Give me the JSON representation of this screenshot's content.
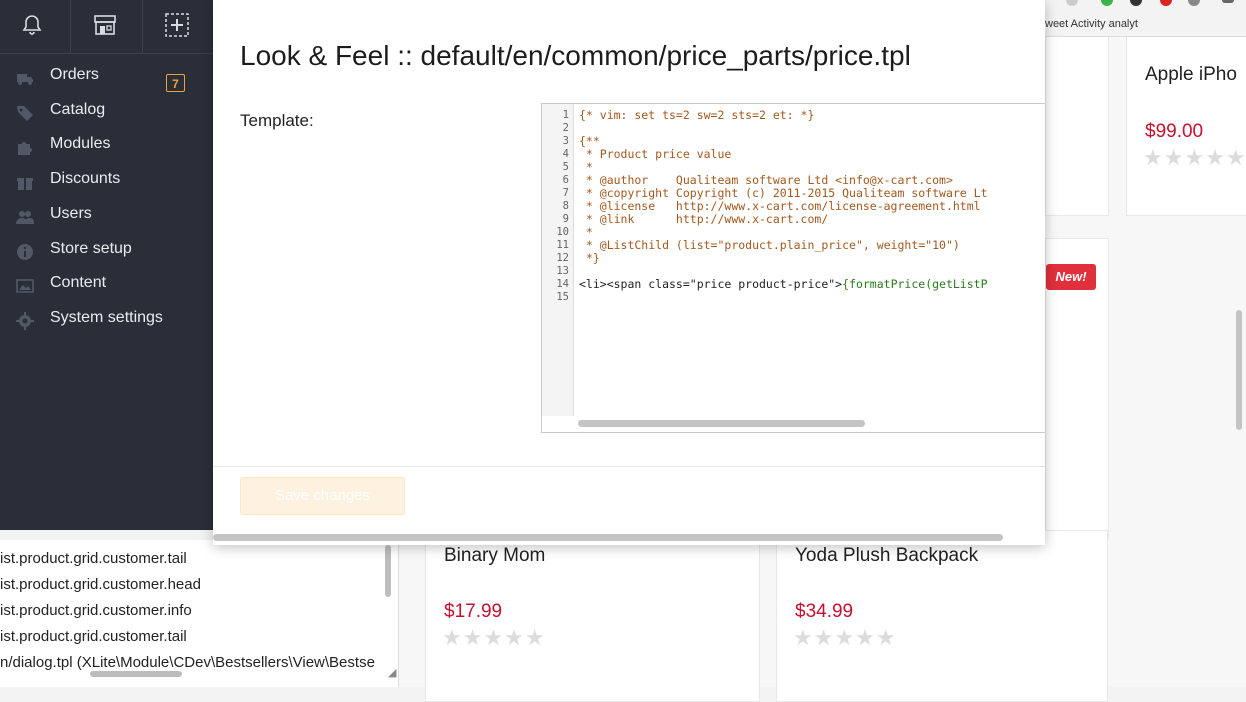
{
  "browser": {
    "tab_text": "weet Activity analyt"
  },
  "sidebar": {
    "toolbar": [
      {
        "icon": "bell-icon"
      },
      {
        "icon": "storefront-icon"
      },
      {
        "icon": "add-box-icon"
      }
    ],
    "items": [
      {
        "label": "Orders",
        "icon": "truck-icon",
        "badge": "7"
      },
      {
        "label": "Catalog",
        "icon": "tags-icon"
      },
      {
        "label": "Modules",
        "icon": "puzzle-icon"
      },
      {
        "label": "Discounts",
        "icon": "gift-icon"
      },
      {
        "label": "Users",
        "icon": "users-icon"
      },
      {
        "label": "Store setup",
        "icon": "info-icon"
      },
      {
        "label": "Content",
        "icon": "image-icon"
      },
      {
        "label": "System settings",
        "icon": "gear-icon"
      }
    ]
  },
  "modal": {
    "title": "Look & Feel :: default/en/common/price_parts/price.tpl",
    "template_label": "Template:",
    "save_label": "Save changes",
    "code_lines": [
      "1",
      "2",
      "3",
      "4",
      "5",
      "6",
      "7",
      "8",
      "9",
      "10",
      "11",
      "12",
      "13",
      "14",
      "15"
    ],
    "code": [
      "{* vim: set ts=2 sw=2 sts=2 et: *}",
      "",
      "{**",
      " * Product price value",
      " *",
      " * @author    Qualiteam software Ltd <info@x-cart.com>",
      " * @copyright Copyright (c) 2011-2015 Qualiteam software Lt",
      " * @license   http://www.x-cart.com/license-agreement.html",
      " * @link      http://www.x-cart.com/",
      " *",
      " * @ListChild (list=\"product.plain_price\", weight=\"10\")",
      " *}",
      "",
      "<li><span class=\"price product-price\">",
      "{formatPrice(getListP",
      ""
    ]
  },
  "store": {
    "badge_new": "New!",
    "products": [
      {
        "name": "Apple iPho",
        "price": "$99.00"
      },
      {
        "name": "Binary Mom",
        "price": "$17.99"
      },
      {
        "name": "Yoda Plush Backpack",
        "price": "$34.99"
      }
    ],
    "stars": "★★★★★"
  },
  "list_panel": {
    "lines": [
      "ist.product.grid.customer.tail",
      "ist.product.grid.customer.head",
      "ist.product.grid.customer.info",
      "ist.product.grid.customer.tail",
      "n/dialog.tpl (XLite\\Module\\CDev\\Bestsellers\\View\\Bestse"
    ]
  },
  "colors": {
    "sidebar_bg": "#2a2e38",
    "price_red": "#c8102e",
    "badge_orange": "#f0a23a",
    "new_badge_red": "#e0303b",
    "save_button_bg": "#fdf1e0"
  }
}
